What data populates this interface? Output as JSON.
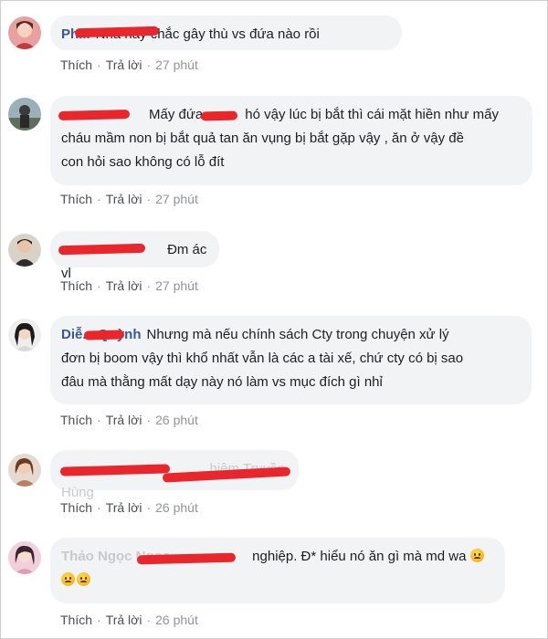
{
  "actions": {
    "like": "Thích",
    "reply": "Trả lời",
    "sep": "·"
  },
  "comments": [
    {
      "name": "Ph...",
      "text": "Nhà này chắc gây thù vs đứa nào rồi",
      "time": "27 phút"
    },
    {
      "name": "",
      "text_line1": "Mấy đứa",
      "text_line1b": "hó vậy lúc bị bắt thì cái mặt hiền như mấy",
      "text_line2": "cháu mầm non bị bắt quả tan ăn vụng bị bắt gặp vậy , ăn ở vậy đề",
      "text_line3": "con hỏi sao không có lỗ đít",
      "time": "27 phút"
    },
    {
      "name": "",
      "text": "Đm ác vl",
      "time": "27 phút"
    },
    {
      "name": "Diễ... Quỳnh",
      "text_line1": "Nhưng mà nếu chính sách Cty trong chuyện xử lý",
      "text_line2": "đơn bị boom vậy thì khổ nhất vẫn là các a tài xế, chứ cty có bị sao",
      "text_line3": "đâu mà thằng mất dạy này nó làm vs mục đích gì nhỉ",
      "time": "26 phút"
    },
    {
      "name": "",
      "text": "...nghiệp. Đ* hiểu nó ăn gì mà md wa",
      "time": "26 phút"
    },
    {
      "name": "",
      "text": "hiệm Truyền Hùng",
      "time": "26 phút"
    }
  ],
  "c5": {
    "name": "Thảo Ngọc Ngọc",
    "text": "nghiệp. Đ* hiểu nó ăn gì mà md wa",
    "time": "26 phút"
  },
  "c4text": "...hiệm Truyền Hùng",
  "colors": {
    "name": "#385898",
    "bubble": "#f2f3f5",
    "redact": "#e8262b"
  }
}
